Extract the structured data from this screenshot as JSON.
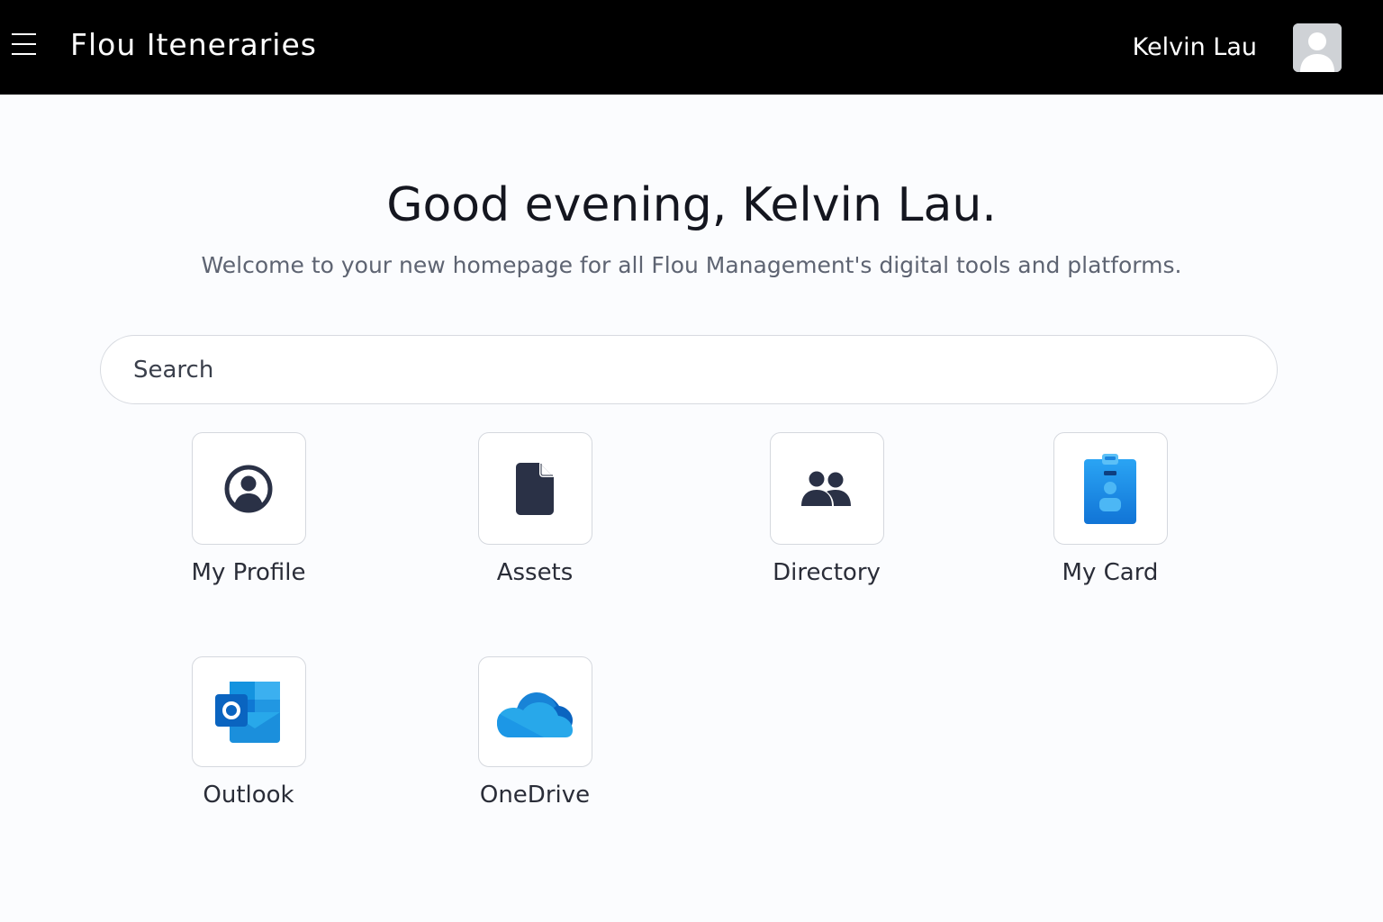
{
  "header": {
    "menu_icon": "hamburger-menu-icon",
    "title": "Flou Iteneraries",
    "user_name": "Kelvin Lau",
    "avatar_icon": "user-avatar-icon"
  },
  "main": {
    "greeting": "Good evening, Kelvin Lau.",
    "subtitle": "Welcome to your new homepage for all Flou Management's digital tools and platforms.",
    "search": {
      "placeholder": "Search",
      "value": ""
    },
    "apps": [
      {
        "label": "My Profile",
        "icon": "user-circle-icon"
      },
      {
        "label": "Assets",
        "icon": "document-icon"
      },
      {
        "label": "Directory",
        "icon": "people-icon"
      },
      {
        "label": "My Card",
        "icon": "id-badge-icon"
      },
      {
        "label": "Outlook",
        "icon": "outlook-icon"
      },
      {
        "label": "OneDrive",
        "icon": "onedrive-icon"
      }
    ]
  },
  "colors": {
    "header_bg": "#000000",
    "page_bg": "#fbfcfe",
    "icon_dark": "#2a3146",
    "microsoft_blue": "#1f8ee6"
  }
}
